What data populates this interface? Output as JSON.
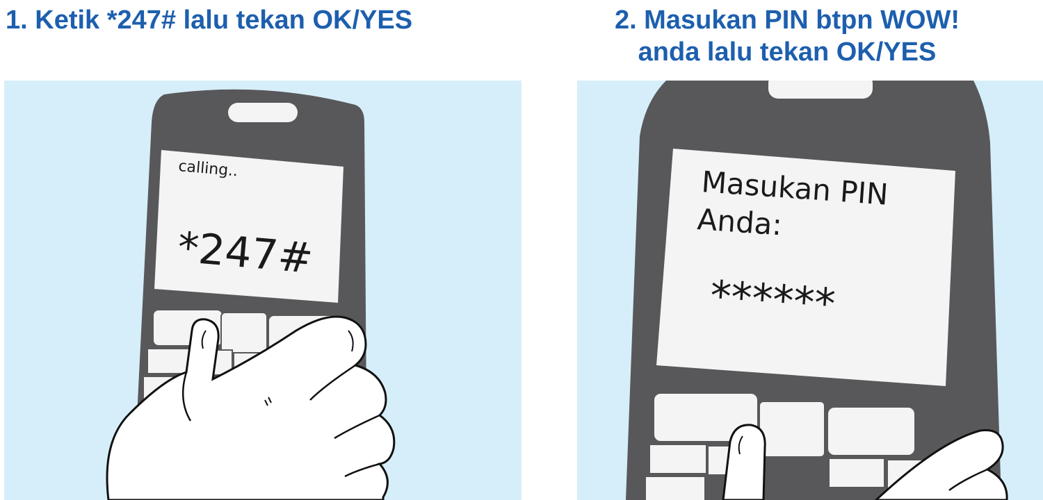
{
  "steps": [
    {
      "title": "1. Ketik *247# lalu tekan OK/YES",
      "screen": {
        "status": "calling..",
        "code": "*247#"
      }
    },
    {
      "title_lines": [
        "2. Masukan PIN btpn WOW!",
        "anda lalu tekan OK/YES"
      ],
      "screen": {
        "prompt_line1": "Masukan PIN",
        "prompt_line2": "Anda:",
        "masked_pin": "******"
      }
    }
  ],
  "colors": {
    "title_blue": "#1d5fae",
    "panel_bg": "#d6eefa",
    "phone_body": "#58585a",
    "screen_bg": "#f4f4f4"
  }
}
